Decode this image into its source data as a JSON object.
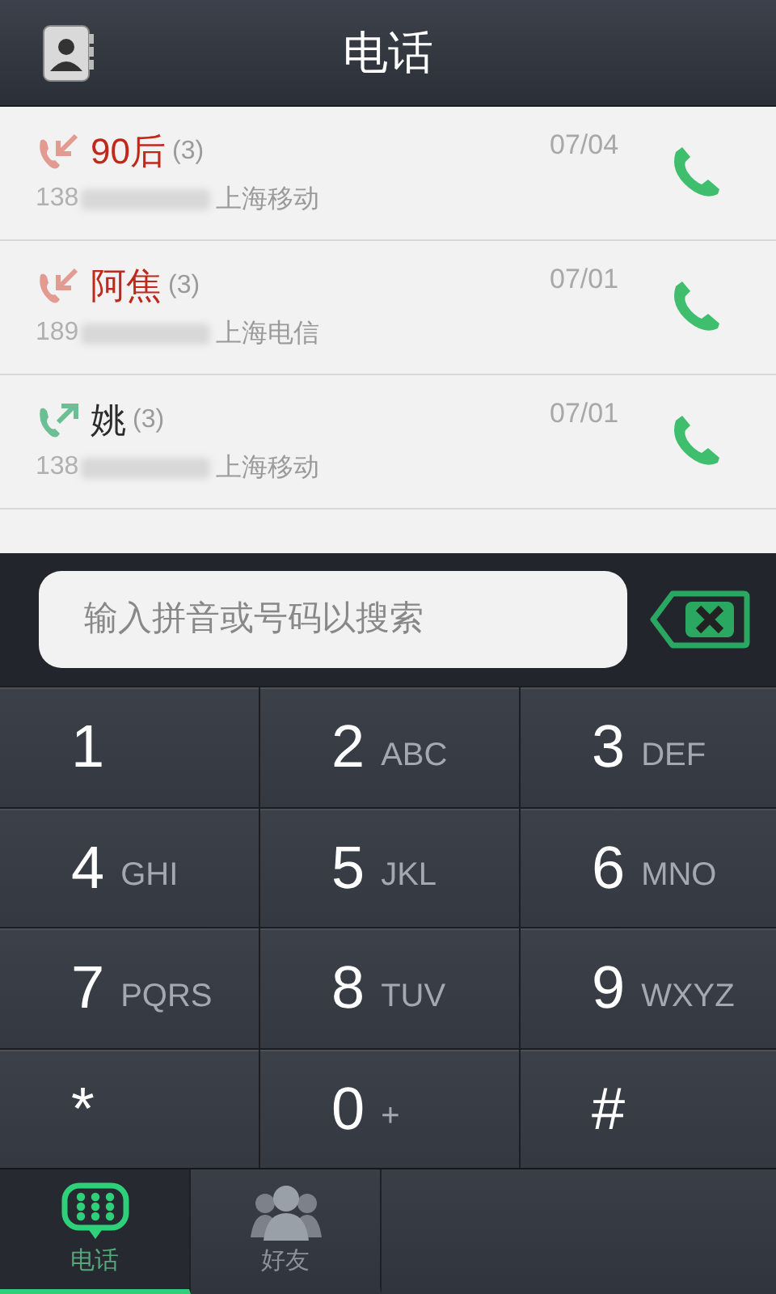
{
  "header": {
    "title": "电话"
  },
  "calls": [
    {
      "kind": "missed",
      "name": "90后",
      "count": "(3)",
      "number_prefix": "138",
      "carrier": "上海移动",
      "date": "07/04"
    },
    {
      "kind": "missed",
      "name": "阿焦",
      "count": "(3)",
      "number_prefix": "189",
      "carrier": "上海电信",
      "date": "07/01"
    },
    {
      "kind": "outgoing",
      "name": "姚",
      "count": "(3)",
      "number_prefix": "138",
      "carrier": "上海移动",
      "date": "07/01"
    }
  ],
  "search": {
    "placeholder": "输入拼音或号码以搜索"
  },
  "keys": [
    {
      "digit": "1"
    },
    {
      "digit": "2",
      "letters": "ABC"
    },
    {
      "digit": "3",
      "letters": "DEF"
    },
    {
      "digit": "4",
      "letters": "GHI"
    },
    {
      "digit": "5",
      "letters": "JKL"
    },
    {
      "digit": "6",
      "letters": "MNO"
    },
    {
      "digit": "7",
      "letters": "PQRS"
    },
    {
      "digit": "8",
      "letters": "TUV"
    },
    {
      "digit": "9",
      "letters": "WXYZ"
    },
    {
      "digit": "*"
    },
    {
      "digit": "0",
      "letters": "+"
    },
    {
      "digit": "#"
    }
  ],
  "tabs": [
    {
      "kind": "dialpad",
      "label": "电话",
      "selected": true
    },
    {
      "kind": "friends",
      "label": "好友",
      "selected": false
    }
  ]
}
